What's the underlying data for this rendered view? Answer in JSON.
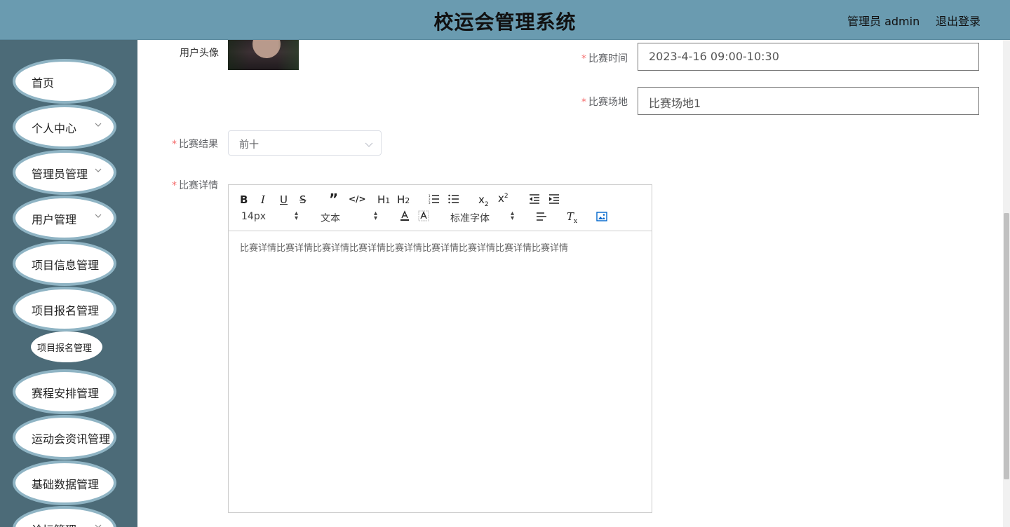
{
  "header": {
    "title": "校运会管理系统",
    "user": "管理员 admin",
    "logout": "退出登录"
  },
  "sidebar": {
    "items": [
      {
        "label": "首页",
        "has_arrow": false
      },
      {
        "label": "个人中心",
        "has_arrow": true
      },
      {
        "label": "管理员管理",
        "has_arrow": true
      },
      {
        "label": "用户管理",
        "has_arrow": true
      },
      {
        "label": "项目信息管理",
        "has_arrow": true
      },
      {
        "label": "项目报名管理",
        "has_arrow": true
      },
      {
        "label": "赛程安排管理",
        "has_arrow": true
      },
      {
        "label": "运动会资讯管理",
        "has_arrow": true
      },
      {
        "label": "基础数据管理",
        "has_arrow": true
      },
      {
        "label": "论坛管理",
        "has_arrow": true
      }
    ],
    "sub_item": "项目报名管理"
  },
  "form": {
    "avatar_label": "用户头像",
    "time_label": "比赛时间",
    "time_value": "2023-4-16 09:00-10:30",
    "venue_label": "比赛场地",
    "venue_value": "比赛场地1",
    "result_label": "比赛结果",
    "result_value": "前十",
    "detail_label": "比赛详情",
    "required_mark": "*"
  },
  "editor": {
    "font_size": "14px",
    "header_select": "文本",
    "font_family": "标准字体",
    "content": "比赛详情比赛详情比赛详情比赛详情比赛详情比赛详情比赛详情比赛详情比赛详情"
  },
  "colors": {
    "header_bg": "#6a9bb0",
    "sidebar_bg": "#4c6b78",
    "menu_ring": "#8fb4c4",
    "required": "#f56c6c"
  }
}
